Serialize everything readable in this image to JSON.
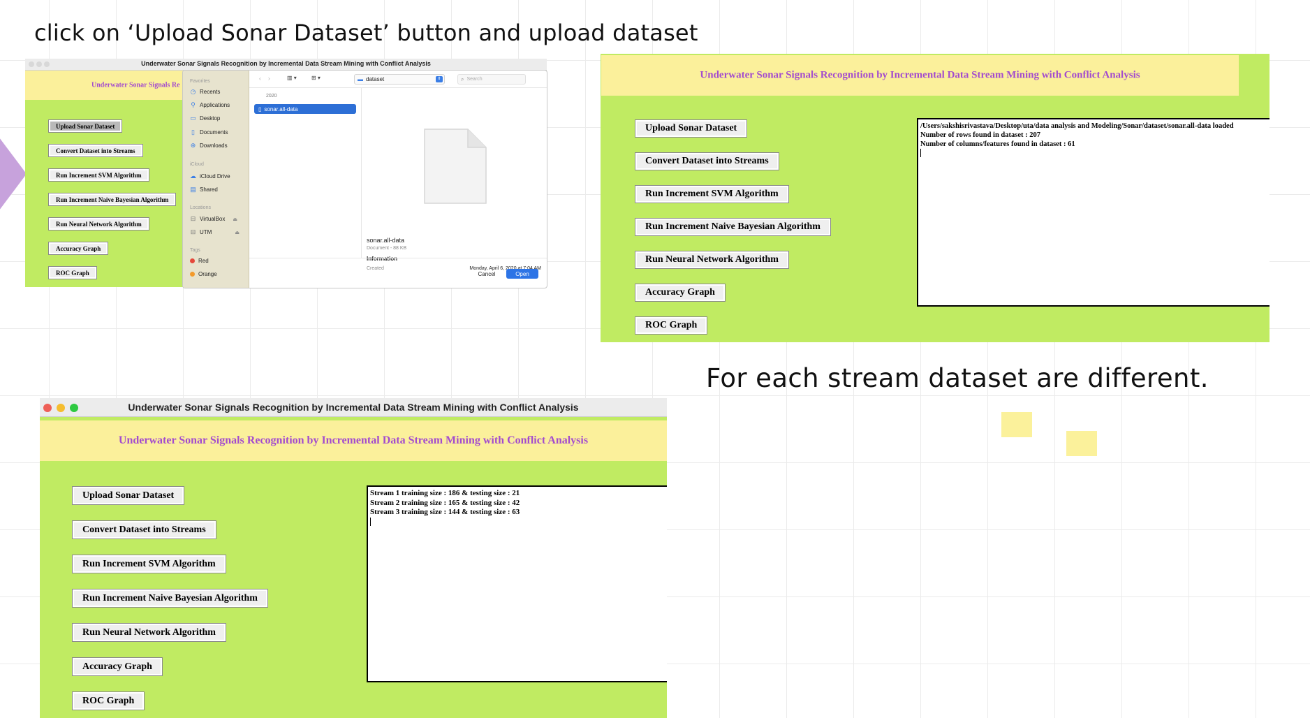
{
  "captions": {
    "top": "click on ‘Upload Sonar Dataset’ button and upload dataset",
    "right": "For each stream dataset are different."
  },
  "app_title": "Underwater Sonar Signals Recognition by Incremental Data Stream Mining with Conflict Analysis",
  "banner_title_truncated": "Underwater Sonar Signals Re",
  "buttons": {
    "upload": "Upload Sonar Dataset",
    "convert": "Convert Dataset into Streams",
    "svm": "Run Increment SVM Algorithm",
    "bayes": "Run Increment Naive Bayesian Algorithm",
    "neural": "Run Neural Network Algorithm",
    "accuracy": "Accuracy Graph",
    "roc": "ROC Graph"
  },
  "dialog": {
    "sidebar": {
      "favorites_label": "Favorites",
      "favorites": [
        "Recents",
        "Applications",
        "Desktop",
        "Documents",
        "Downloads"
      ],
      "icloud_label": "iCloud",
      "icloud": [
        "iCloud Drive",
        "Shared"
      ],
      "locations_label": "Locations",
      "locations": [
        "VirtualBox",
        "UTM"
      ],
      "tags_label": "Tags",
      "tags": [
        "Red",
        "Orange"
      ]
    },
    "folder": "dataset",
    "search_placeholder": "Search",
    "column_header": "2020",
    "selected_file": "sonar.all-data",
    "preview": {
      "name": "sonar.all-data",
      "kind": "Document - 88 KB",
      "info_label": "Information",
      "created_label": "Created",
      "created_value": "Monday, April 6, 2020 at 7:04 AM"
    },
    "cancel": "Cancel",
    "open": "Open"
  },
  "console_dataset": [
    "/Users/sakshisrivastava/Desktop/uta/data analysis and Modeling/Sonar/dataset/sonar.all-data loaded",
    "Number of rows found in dataset : 207",
    "Number of columns/features found in dataset : 61"
  ],
  "console_streams": [
    "Stream 1 training size : 186 & testing size : 21",
    "Stream 2 training size : 165 & testing size : 42",
    "Stream 3 training size : 144 & testing size : 63"
  ],
  "colors": {
    "app_bg": "#c0eb62",
    "banner_bg": "#fbf09b",
    "banner_text": "#a34bce",
    "sticky": "#fbf19b",
    "accent_blue": "#3a7ee6"
  }
}
